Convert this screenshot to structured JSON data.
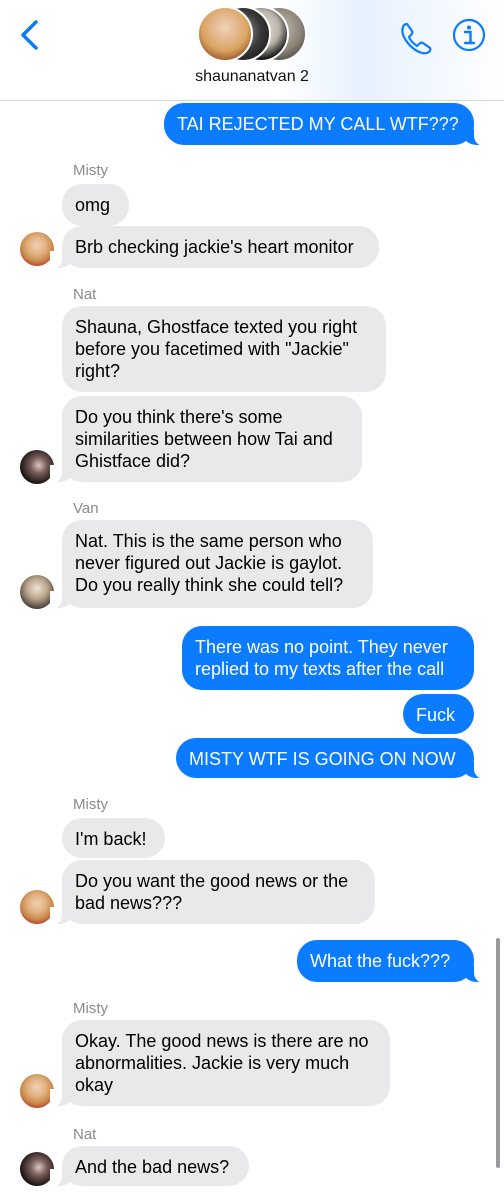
{
  "header": {
    "group_name": "shaunanatvan 2",
    "back_icon": "chevron-left-icon",
    "call_icon": "phone-icon",
    "info_icon": "info-icon",
    "accent": "#0b7bff"
  },
  "messages": [
    {
      "from": "me",
      "text": "TAI REJECTED MY CALL WTF???"
    },
    {
      "sender": "Misty"
    },
    {
      "from": "Misty",
      "text": "omg"
    },
    {
      "from": "Misty",
      "text": "Brb checking jackie's heart monitor"
    },
    {
      "sender": "Nat"
    },
    {
      "from": "Nat",
      "text": "Shauna, Ghostface texted you right before you facetimed with \"Jackie\" right?"
    },
    {
      "from": "Nat",
      "text": "Do you think there's some similarities between how Tai and Ghistface did?"
    },
    {
      "sender": "Van"
    },
    {
      "from": "Van",
      "text": "Nat. This is the same person who never figured out Jackie is gaylot. Do you really think she could tell?"
    },
    {
      "from": "me",
      "text": "There was no point. They never replied to my texts after the call"
    },
    {
      "from": "me",
      "text": "Fuck"
    },
    {
      "from": "me",
      "text": "MISTY WTF IS GOING ON NOW"
    },
    {
      "sender": "Misty"
    },
    {
      "from": "Misty",
      "text": "I'm back!"
    },
    {
      "from": "Misty",
      "text": "Do you want the good news or the bad news???"
    },
    {
      "from": "me",
      "text": "What the fuck???"
    },
    {
      "sender": "Misty"
    },
    {
      "from": "Misty",
      "text": "Okay. The good news is there are no abnormalities. Jackie is very much okay"
    },
    {
      "sender": "Nat"
    },
    {
      "from": "Nat",
      "text": "And the bad news?"
    }
  ]
}
